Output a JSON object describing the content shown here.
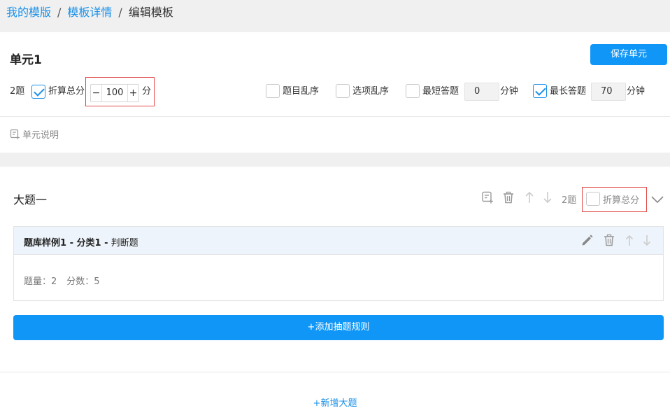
{
  "breadcrumb": {
    "items": [
      "我的模版",
      "模板详情",
      "编辑模板"
    ],
    "separator": "/"
  },
  "unit": {
    "title": "单元1",
    "save_label": "保存单元",
    "question_count": "2题",
    "fold_score_label": "折算总分",
    "fold_score_checked": true,
    "score_value": "100",
    "score_unit": "分",
    "shuffle_questions_label": "题目乱序",
    "shuffle_questions_checked": false,
    "shuffle_options_label": "选项乱序",
    "shuffle_options_checked": false,
    "min_time_label": "最短答题",
    "min_time_checked": false,
    "min_time_value": "0",
    "max_time_label": "最长答题",
    "max_time_checked": true,
    "max_time_value": "70",
    "time_unit": "分钟",
    "description_label": "单元说明"
  },
  "section": {
    "title": "大题一",
    "question_count": "2题",
    "fold_score_label": "折算总分",
    "fold_score_checked": false,
    "rule": {
      "source": "题库样例1 - 分类1 -",
      "type": "判断题",
      "quantity": "题量：2",
      "score": "分数：5"
    },
    "add_rule_label": "+添加抽题规则"
  },
  "add_section_label": "+新增大题",
  "colors": {
    "primary": "#0f96f7",
    "link": "#1a90e8",
    "highlight_border": "#e04848"
  }
}
